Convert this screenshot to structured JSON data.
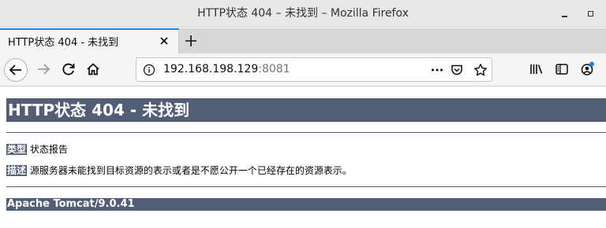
{
  "window": {
    "title": "HTTP状态 404 – 未找到 – Mozilla Firefox"
  },
  "tab": {
    "title": "HTTP状态 404 - 未找到"
  },
  "urlbar": {
    "host": "192.168.198.129",
    "port": ":8081"
  },
  "icons": {
    "back": "back-arrow-icon",
    "forward": "forward-arrow-icon",
    "reload": "reload-icon",
    "home": "home-icon",
    "info": "info-icon",
    "page_actions": "more-dots-icon",
    "pocket": "pocket-icon",
    "bookmark": "star-icon",
    "library": "library-icon",
    "sidebar": "sidebar-icon",
    "account": "account-icon"
  },
  "page": {
    "heading": "HTTP状态 404 - 未找到",
    "type_label": "类型",
    "type_value": " 状态报告",
    "desc_label": "描述",
    "desc_value": " 源服务器未能找到目标资源的表示或者是不愿公开一个已经存在的资源表示。",
    "footer": "Apache Tomcat/9.0.41"
  },
  "colors": {
    "tomcat_header": "#525d76",
    "tab_accent": "#0a84ff"
  }
}
